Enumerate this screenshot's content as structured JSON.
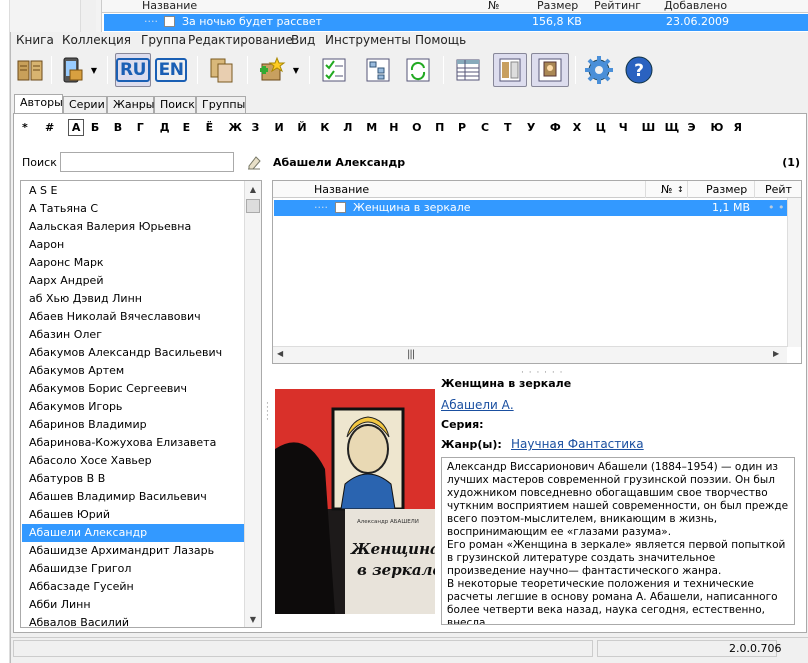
{
  "background_window": {
    "columns": [
      "Название",
      "№",
      "Размер",
      "Рейтинг",
      "Добавлено"
    ],
    "selected_row": {
      "title": "За ночью будет рассвет",
      "size": "156,8 KB",
      "added": "23.06.2009"
    }
  },
  "menu": [
    "Книга",
    "Коллекция",
    "Группа",
    "Редактирование",
    "Вид",
    "Инструменты",
    "Помощь"
  ],
  "toolbar": {
    "lang_ru": "RU",
    "lang_en": "EN",
    "icons": [
      "book-open-icon",
      "device-icon",
      "language-ru-icon",
      "language-en-icon",
      "copy-icon",
      "add-to-group-icon",
      "check-list-icon",
      "tree-view-icon",
      "refresh-list-icon",
      "table-view-icon",
      "split-view-icon",
      "cover-view-icon",
      "gear-icon",
      "help-icon"
    ]
  },
  "tabs": [
    "Авторы",
    "Серии",
    "Жанры",
    "Поиск",
    "Группы"
  ],
  "alphabet": [
    "*",
    "#",
    "А",
    "Б",
    "В",
    "Г",
    "Д",
    "Е",
    "Ё",
    "Ж",
    "З",
    "И",
    "Й",
    "К",
    "Л",
    "М",
    "Н",
    "О",
    "П",
    "Р",
    "С",
    "Т",
    "У",
    "Ф",
    "Х",
    "Ц",
    "Ч",
    "Ш",
    "Щ",
    "Э",
    "Ю",
    "Я"
  ],
  "alphabet_selected": "А",
  "search": {
    "label": "Поиск",
    "value": ""
  },
  "authors": [
    "A S E",
    "А Татьяна С",
    "Аальская Валерия Юрьевна",
    "Аарон",
    "Ааронс Марк",
    "Аарх Андрей",
    "аб Хью Дэвид Линн",
    "Абаев Николай Вячеславович",
    "Абазин Олег",
    "Абакумов Александр Васильевич",
    "Абакумов Артем",
    "Абакумов Борис Сергеевич",
    "Абакумов Игорь",
    "Абаринов Владимир",
    "Абаринова-Кожухова Елизавета",
    "Абасоло Хосе Хавьер",
    "Абатуров В В",
    "Абашев Владимир Васильевич",
    "Абашев Юрий",
    "Абашели Александр",
    "Абашидзе Архимандрит Лазарь",
    "Абашидзе Григол",
    "Аббасзаде Гусейн",
    "Абби Линн",
    "Абвалов Василий"
  ],
  "selected_author": "Абашели Александр",
  "author_panel": {
    "title": "Абашели Александр",
    "count": "(1)"
  },
  "book_table": {
    "columns": [
      "Название",
      "№",
      "Размер",
      "Рейт"
    ],
    "rows": [
      {
        "title": "Женщина в зеркале",
        "size": "1,1 MB"
      }
    ]
  },
  "book_info": {
    "title": "Женщина в зеркале",
    "author": "Абашели А.",
    "series_label": "Серия:",
    "genre_label": "Жанр(ы):",
    "genre": "Научная Фантастика",
    "annotation": [
      "Александр Виссарионович Абашели (1884–1954) — один из лучших мастеров современной грузинской поэзии. Он был художником повседневно обогащавшим свое творчество чуткним восприятием нашей современности, он был прежде всего поэтом-мыслителем, вникающим в жизнь, воспринимающим ее «глазами разума».",
      "Его роман «Женщина в зеркале» является первой попыткой в грузинской литературе создать значительное произведение научно— фантастического жанра.",
      "В некоторые теоретические положения и технические расчеты легшие в основу романа А. Абашели, написанного более четверти века назад, наука сегодня, естественно, внесла"
    ],
    "cover_author": "Александр АБАШЕЛИ",
    "cover_title_line1": "Женщина",
    "cover_title_line2": "в зеркале"
  },
  "status": {
    "version": "2.0.0.706"
  },
  "colors": {
    "selection": "#3399ff",
    "link": "#1a4fa0",
    "window_bg": "#f0f0f0"
  }
}
